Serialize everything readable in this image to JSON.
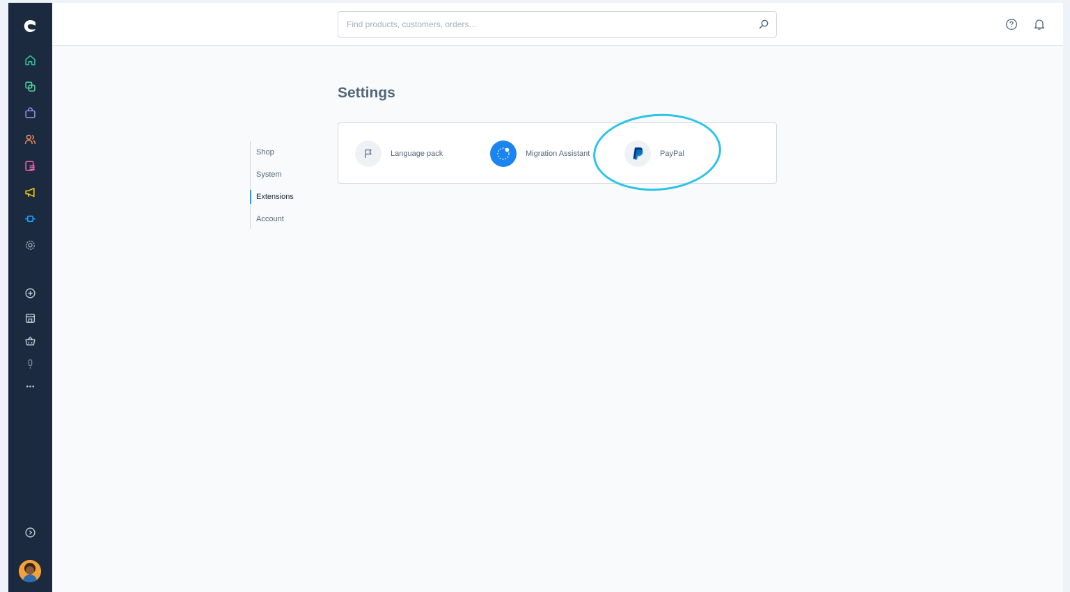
{
  "sidebar": {
    "logo_icon": "shopware-logo",
    "items": [
      {
        "name": "dashboard-icon",
        "color": "#2ecc9c"
      },
      {
        "name": "catalogues-icon",
        "color": "#57d9a3"
      },
      {
        "name": "orders-icon",
        "color": "#a092f0"
      },
      {
        "name": "customers-icon",
        "color": "#f88962"
      },
      {
        "name": "content-icon",
        "color": "#ff68b4"
      },
      {
        "name": "marketing-icon",
        "color": "#ffd700"
      },
      {
        "name": "extensions-icon",
        "color": "#189eff"
      },
      {
        "name": "settings-icon",
        "color": "#9aa8b5"
      }
    ],
    "sales_channel_icons": [
      "add-circle-icon",
      "storefront-icon",
      "basket-icon",
      "voice-icon",
      "more-icon"
    ],
    "collapse_icon": "chevron-circle-icon"
  },
  "header": {
    "search_placeholder": "Find products, customers, orders…",
    "help_icon": "help-icon",
    "notifications_icon": "bell-icon"
  },
  "main": {
    "title": "Settings",
    "nav": [
      {
        "label": "Shop",
        "active": false
      },
      {
        "label": "System",
        "active": false
      },
      {
        "label": "Extensions",
        "active": true
      },
      {
        "label": "Account",
        "active": false
      }
    ],
    "extensions": [
      {
        "label": "Language pack",
        "icon": "flag-icon"
      },
      {
        "label": "Migration Assistant",
        "icon": "migration-icon"
      },
      {
        "label": "PayPal",
        "icon": "paypal-icon"
      }
    ]
  },
  "colors": {
    "accent": "#189eff",
    "highlight": "#2bc3e6",
    "sidebar_bg": "#1b2a3f"
  }
}
